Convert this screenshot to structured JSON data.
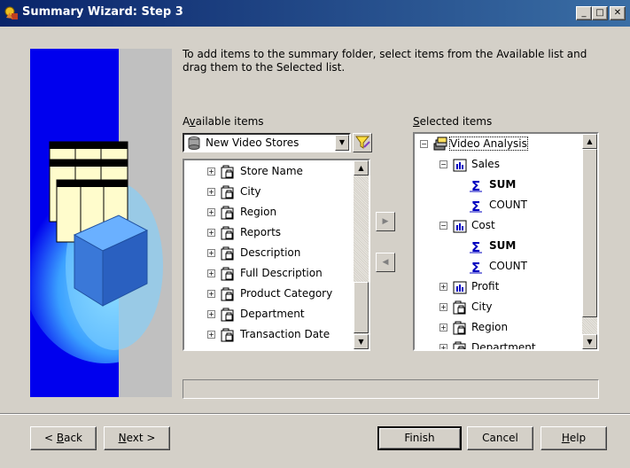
{
  "window": {
    "title": "Summary Wizard: Step 3",
    "min_label": "_",
    "max_label": "□",
    "close_label": "✕"
  },
  "instruction": "To add items to the summary folder, select items from the Available list and drag them to the Selected list.",
  "available": {
    "label_pre": "A",
    "label_u": "v",
    "label_post": "ailable items",
    "business_area": "New Video Stores",
    "items": [
      {
        "label": "Store Name",
        "expanded": false
      },
      {
        "label": "City",
        "expanded": false
      },
      {
        "label": "Region",
        "expanded": false
      },
      {
        "label": "Reports",
        "expanded": false
      },
      {
        "label": "Description",
        "expanded": false
      },
      {
        "label": "Full Description",
        "expanded": false
      },
      {
        "label": "Product Category",
        "expanded": false
      },
      {
        "label": "Department",
        "expanded": false
      },
      {
        "label": "Transaction Date",
        "expanded": false
      }
    ]
  },
  "selected": {
    "label_u": "S",
    "label_post": "elected items",
    "root": "Video Analysis",
    "items": [
      {
        "label": "Sales",
        "type": "measure"
      },
      {
        "label": "SUM",
        "type": "aggregate",
        "bold": true
      },
      {
        "label": "COUNT",
        "type": "aggregate",
        "bold": false
      },
      {
        "label": "Cost",
        "type": "measure"
      },
      {
        "label": "SUM",
        "type": "aggregate",
        "bold": true
      },
      {
        "label": "COUNT",
        "type": "aggregate",
        "bold": false
      },
      {
        "label": "Profit",
        "type": "measure"
      },
      {
        "label": "City",
        "type": "folder"
      },
      {
        "label": "Region",
        "type": "folder"
      },
      {
        "label": "Department",
        "type": "folder"
      }
    ]
  },
  "buttons": {
    "back_u": "B",
    "back_post": "ack",
    "back_prefix": "< ",
    "next_u": "N",
    "next_post": "ext >",
    "finish": "Finish",
    "cancel": "Cancel",
    "help_u": "H",
    "help_post": "elp"
  },
  "colors": {
    "titlebar_start": "#0a246a",
    "titlebar_end": "#3a6ea5",
    "dialog_bg": "#d4d0c8",
    "side_blue": "#0000ee"
  }
}
